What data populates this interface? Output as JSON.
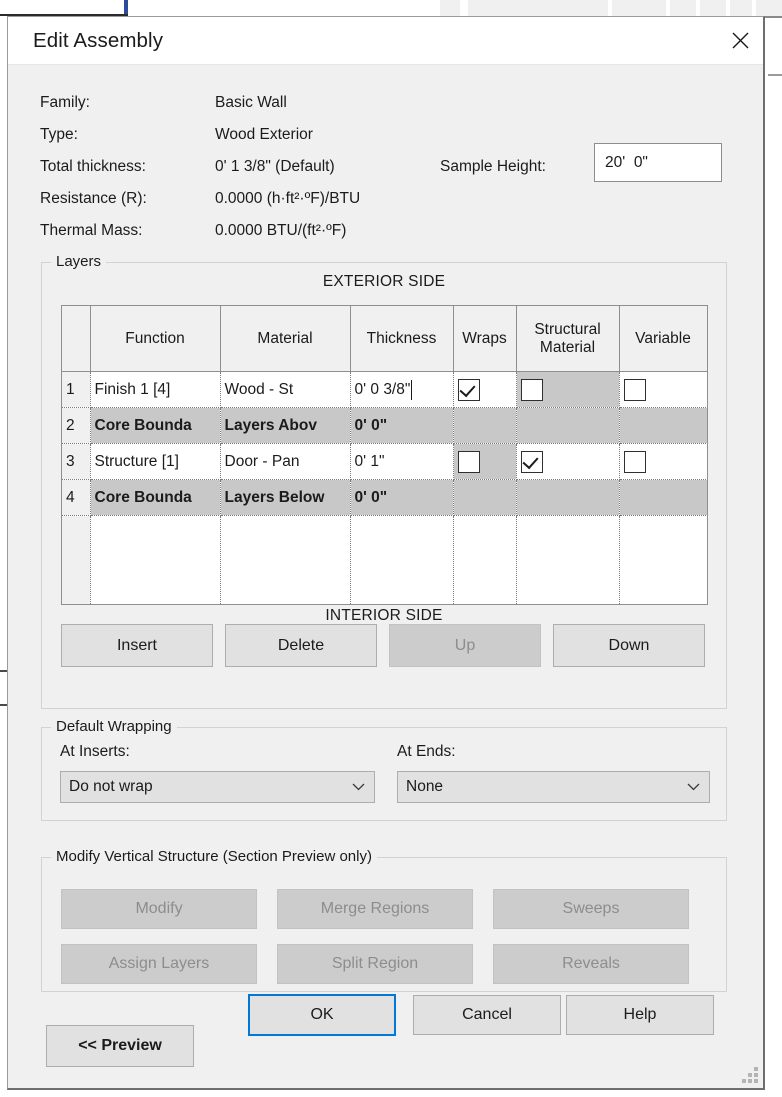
{
  "window": {
    "title": "Edit Assembly",
    "close_icon": "close-icon",
    "accent_color": "#0078d7",
    "dialog_bg": "#f0f0f0",
    "titlebar_bg": "#ffffff"
  },
  "properties": [
    {
      "label": "Family:",
      "value": "Basic Wall"
    },
    {
      "label": "Type:",
      "value": "Wood Exterior"
    },
    {
      "label": "Total thickness:",
      "value": "0'  1 3/8\" (Default)"
    },
    {
      "label": "Resistance (R):",
      "value": "0.0000 (h·ft²·ºF)/BTU"
    },
    {
      "label": "Thermal Mass:",
      "value": "0.0000 BTU/(ft²·ºF)"
    }
  ],
  "sample_height": {
    "label": "Sample Height:",
    "value": "20'  0\"",
    "placeholder": ""
  },
  "layers": {
    "caption": "Layers",
    "exterior_label": "EXTERIOR SIDE",
    "interior_label": "INTERIOR SIDE",
    "columns": [
      "",
      "Function",
      "Material",
      "Thickness",
      "Wraps",
      "Structural Material",
      "Variable"
    ],
    "rows": [
      {
        "index": "1",
        "function": "Finish 1 [4]",
        "material": "Wood - St",
        "thickness": "0'  0 3/8\"",
        "thickness_editing": true,
        "wraps": true,
        "wraps_shaded": false,
        "structural": false,
        "structural_shaded": true,
        "variable": false,
        "variable_shaded": false,
        "core": false
      },
      {
        "index": "2",
        "function": "Core Bounda",
        "material": "Layers Abov",
        "thickness": "0'  0\"",
        "thickness_editing": false,
        "wraps": null,
        "structural": null,
        "variable": null,
        "core": true
      },
      {
        "index": "3",
        "function": "Structure [1]",
        "material": "Door - Pan",
        "thickness": "0'  1\"",
        "thickness_editing": false,
        "wraps": false,
        "wraps_shaded": true,
        "structural": true,
        "structural_shaded": false,
        "variable": false,
        "variable_shaded": false,
        "core": false
      },
      {
        "index": "4",
        "function": "Core Bounda",
        "material": "Layers Below",
        "thickness": "0'  0\"",
        "thickness_editing": false,
        "wraps": null,
        "structural": null,
        "variable": null,
        "core": true
      }
    ],
    "buttons": [
      {
        "label": "Insert",
        "enabled": true
      },
      {
        "label": "Delete",
        "enabled": true
      },
      {
        "label": "Up",
        "enabled": false
      },
      {
        "label": "Down",
        "enabled": true
      }
    ]
  },
  "default_wrapping": {
    "caption": "Default Wrapping",
    "at_inserts": {
      "label": "At Inserts:",
      "value": "Do not wrap"
    },
    "at_ends": {
      "label": "At  Ends:",
      "value": "None"
    }
  },
  "vertical_structure": {
    "caption": "Modify Vertical Structure (Section Preview only)",
    "buttons": [
      {
        "label": "Modify",
        "enabled": false
      },
      {
        "label": "Merge Regions",
        "enabled": false
      },
      {
        "label": "Sweeps",
        "enabled": false
      },
      {
        "label": "Assign Layers",
        "enabled": false
      },
      {
        "label": "Split Region",
        "enabled": false
      },
      {
        "label": "Reveals",
        "enabled": false
      }
    ]
  },
  "footer": {
    "ok": "OK",
    "cancel": "Cancel",
    "help": "Help",
    "preview": "<< Preview"
  }
}
